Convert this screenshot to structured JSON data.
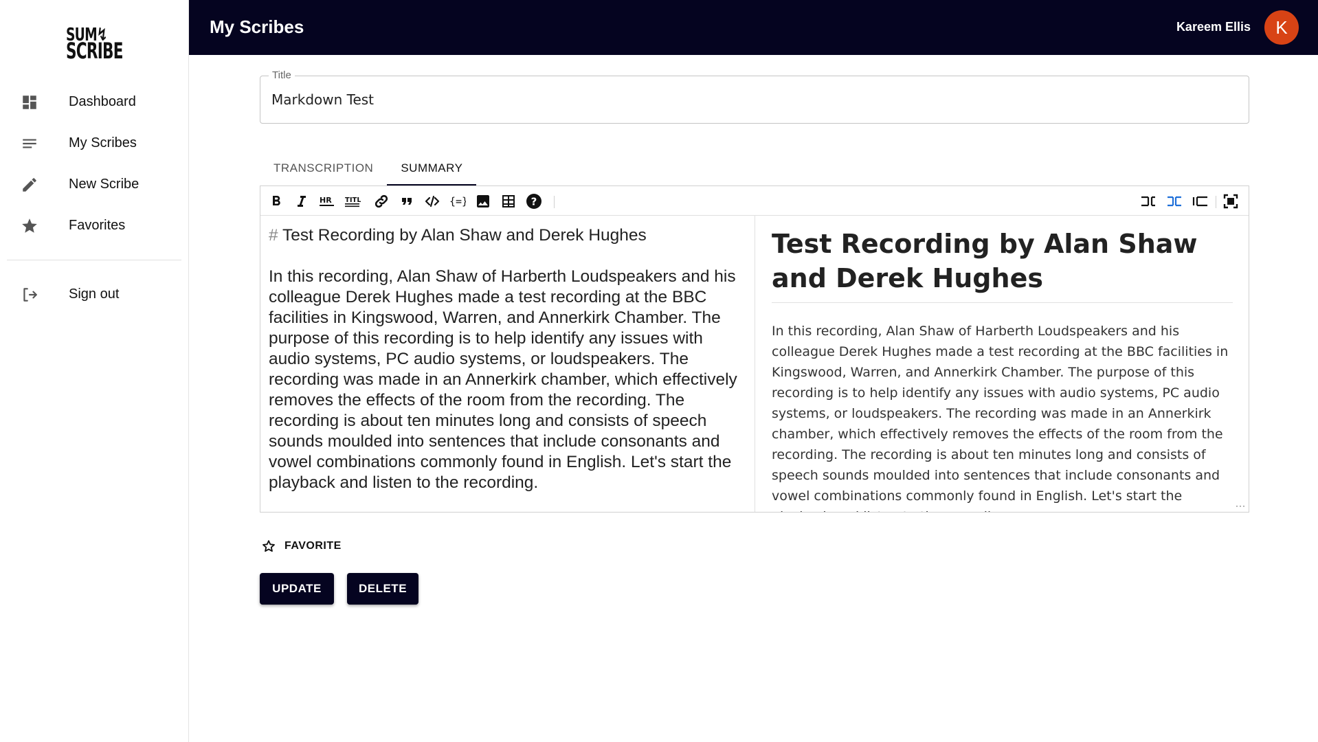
{
  "brand": {
    "logo_line1": "SUM↯",
    "logo_line2": "SCRIBE"
  },
  "sidebar": {
    "items": [
      {
        "label": "Dashboard",
        "icon": "dashboard-icon"
      },
      {
        "label": "My Scribes",
        "icon": "list-icon"
      },
      {
        "label": "New Scribe",
        "icon": "pencil-icon"
      },
      {
        "label": "Favorites",
        "icon": "star-icon"
      }
    ],
    "signout": {
      "label": "Sign out",
      "icon": "logout-icon"
    }
  },
  "header": {
    "title": "My Scribes",
    "user_name": "Kareem Ellis",
    "avatar_initial": "K",
    "avatar_color": "#d84315",
    "bg_color": "#050420"
  },
  "form": {
    "title_label": "Title",
    "title_value": "Markdown Test"
  },
  "tabs": [
    {
      "label": "TRANSCRIPTION",
      "active": false
    },
    {
      "label": "SUMMARY",
      "active": true
    }
  ],
  "toolbar": {
    "left": [
      "bold-icon",
      "italic-icon",
      "horizontal-rule-icon",
      "title-icon",
      "link-icon",
      "quote-icon",
      "code-icon",
      "code-block-icon",
      "image-icon",
      "table-icon",
      "help-icon"
    ],
    "right": [
      "edit-mode-icon",
      "live-mode-icon",
      "preview-mode-icon",
      "fullscreen-icon"
    ]
  },
  "editor": {
    "heading_marker": "#",
    "heading_text": "Test Recording by Alan Shaw and Derek Hughes",
    "body": "In this recording, Alan Shaw of Harberth Loudspeakers and his colleague Derek Hughes made a test recording at the BBC facilities in Kingswood, Warren, and Annerkirk Chamber. The purpose of this recording is to help identify any issues with audio systems, PC audio systems, or loudspeakers. The recording was made in an Annerkirk chamber, which effectively removes the effects of the room from the recording. The recording is about ten minutes long and consists of speech sounds moulded into sentences that include consonants and vowel combinations commonly found in English. Let's start the playback and listen to the recording."
  },
  "preview": {
    "heading": "Test Recording by Alan Shaw and Derek Hughes",
    "body": "In this recording, Alan Shaw of Harberth Loudspeakers and his colleague Derek Hughes made a test recording at the BBC facilities in Kingswood, Warren, and Annerkirk Chamber. The purpose of this recording is to help identify any issues with audio systems, PC audio systems, or loudspeakers. The recording was made in an Annerkirk chamber, which effectively removes the effects of the room from the recording. The recording is about ten minutes long and consists of speech sounds moulded into sentences that include consonants and vowel combinations commonly found in English. Let's start the playback and listen to the recording."
  },
  "actions": {
    "favorite_label": "FAVORITE",
    "update_label": "UPDATE",
    "delete_label": "DELETE"
  }
}
